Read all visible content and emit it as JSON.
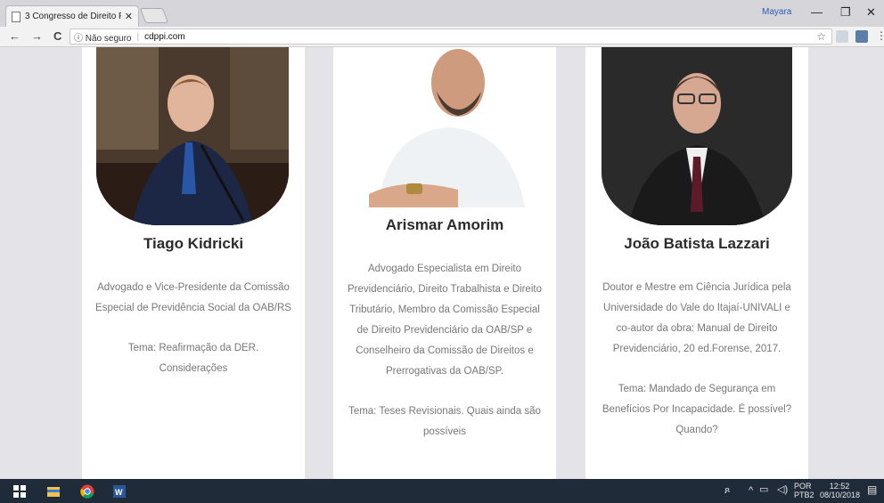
{
  "browser": {
    "tab_title": "3 Congresso de Direito P",
    "tab_close": "✕",
    "profile_name": "Mayara",
    "window_controls": [
      "—",
      "❐",
      "✕"
    ],
    "nav": [
      "←",
      "→",
      "C"
    ],
    "security_label": "ⓘ Não seguro",
    "url": "cdppi.com",
    "bookmark_icon": "☆"
  },
  "speakers": [
    {
      "name": "Tiago Kidricki",
      "bio": "Advogado e Vice-Presidente da Comissão Especial de Previdência Social da OAB/RS",
      "topic": "Tema: Reafirmação da DER. Considerações"
    },
    {
      "name": "Arismar Amorim",
      "bio": "Advogado Especialista em Direito Previdenciário, Direito Trabalhista e Direito Tributário, Membro da Comissão Especial de Direito Previdenciário da OAB/SP e Conselheiro da Comissão de Direitos e Prerrogativas da OAB/SP.",
      "topic": "Tema: Teses Revisionais. Quais ainda são possíveis"
    },
    {
      "name": "João Batista Lazzari",
      "bio": "Doutor e Mestre em Ciência Jurídica pela Universidade do Vale do Itajaí-UNIVALI e co-autor da obra: Manual de Direito Previdenciário, 20 ed.Forense, 2017.",
      "topic": "Tema: Mandado de Segurança em Benefícios Por Incapacidade. É possível? Quando?"
    }
  ],
  "taskbar": {
    "language": "POR",
    "keyboard": "PTB2",
    "time": "12:52",
    "date": "08/10/2018"
  },
  "colors": {
    "page_bg": "#e4e4e8",
    "card_bg": "#ffffff",
    "name_text": "#2b2b2b",
    "body_text": "#777777",
    "taskbar_bg": "#1f2b38"
  }
}
